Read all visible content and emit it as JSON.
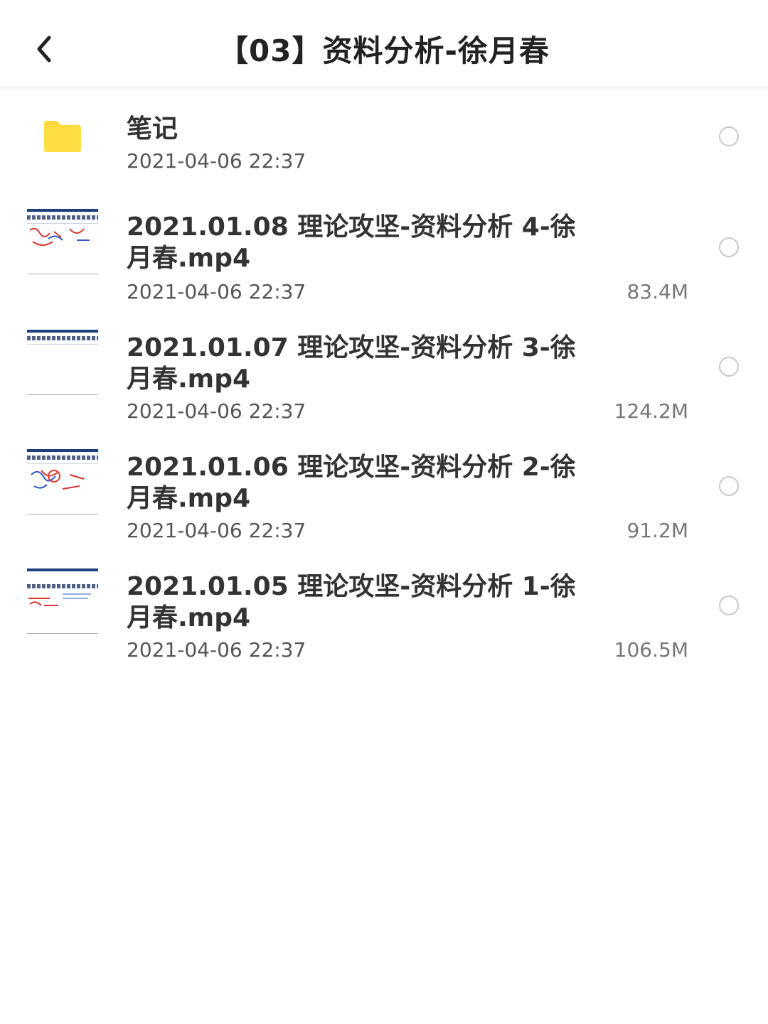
{
  "header": {
    "title": "【03】资料分析-徐月春",
    "back_icon": "chevron-left-icon"
  },
  "items": [
    {
      "type": "folder",
      "icon": "folder-icon",
      "name": "笔记",
      "date": "2021-04-06 22:37",
      "size": ""
    },
    {
      "type": "video",
      "icon": "video-thumbnail",
      "name": "2021.01.08 理论攻坚-资料分析 4-徐月春.mp4",
      "date": "2021-04-06 22:37",
      "size": "83.4M"
    },
    {
      "type": "video",
      "icon": "video-thumbnail",
      "name": "2021.01.07 理论攻坚-资料分析 3-徐月春.mp4",
      "date": "2021-04-06 22:37",
      "size": "124.2M"
    },
    {
      "type": "video",
      "icon": "video-thumbnail",
      "name": "2021.01.06 理论攻坚-资料分析 2-徐月春.mp4",
      "date": "2021-04-06 22:37",
      "size": "91.2M"
    },
    {
      "type": "video",
      "icon": "video-thumbnail",
      "name": "2021.01.05 理论攻坚-资料分析 1-徐月春.mp4",
      "date": "2021-04-06 22:37",
      "size": "106.5M"
    }
  ],
  "colors": {
    "folder": "#FFD93D",
    "text": "#333333",
    "radio_border": "#C8C8C8"
  }
}
